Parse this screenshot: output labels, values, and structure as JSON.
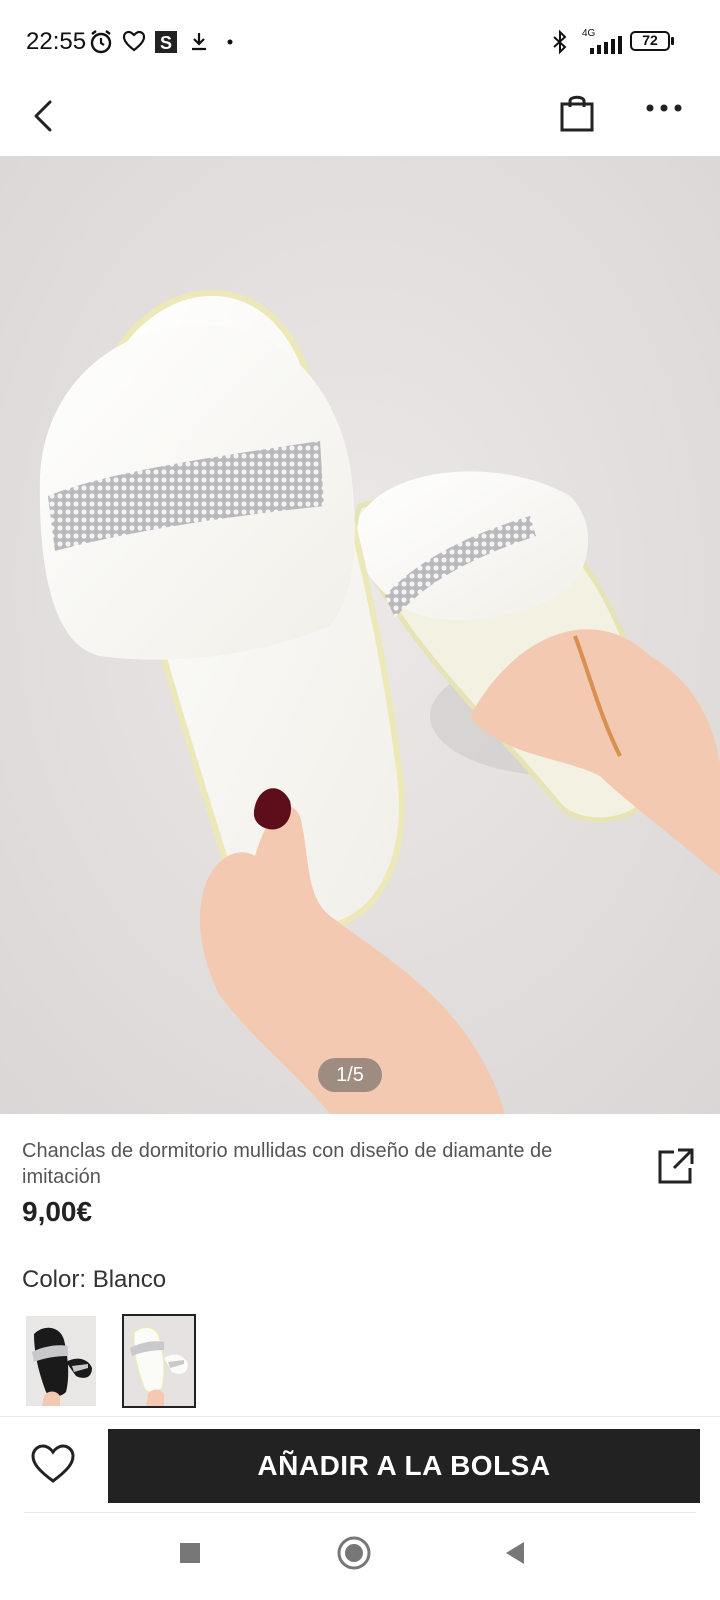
{
  "status_bar": {
    "time": "22:55",
    "network": "4G",
    "battery": "72",
    "icons": [
      "alarm-icon",
      "heart-outline-icon",
      "s-app-icon",
      "download-icon",
      "dot-icon",
      "bluetooth-icon",
      "signal-icon",
      "battery-icon"
    ]
  },
  "top_bar": {
    "icons": [
      "back-chevron-icon",
      "shopping-bag-icon",
      "more-dots-icon"
    ]
  },
  "gallery": {
    "counter": "1/5",
    "current_image": 1,
    "total_images": 5
  },
  "product": {
    "title": "Chanclas de dormitorio mullidas con diseño de diamante de imitación",
    "price": "9,00€"
  },
  "color": {
    "label": "Color: Blanco",
    "swatches": [
      "black-slipper-swatch",
      "white-slipper-swatch"
    ],
    "selected_index": 1
  },
  "actions": {
    "add_to_bag": "AÑADIR A LA BOLSA"
  },
  "colors": {
    "button_bg": "#222222",
    "button_text": "#ffffff",
    "photo_bg": "#e6e2e1"
  }
}
